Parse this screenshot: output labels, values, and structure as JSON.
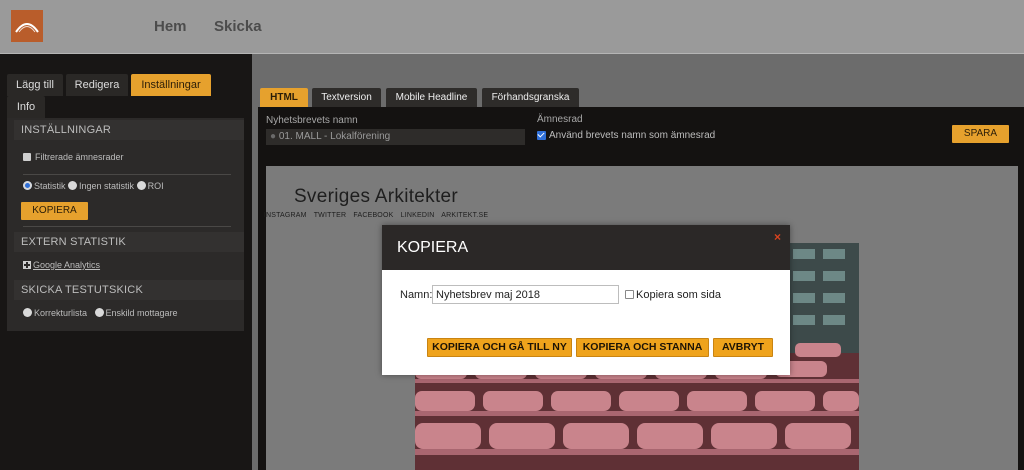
{
  "topnav": {
    "home": "Hem",
    "send": "Skicka"
  },
  "left": {
    "tabs": {
      "add": "Lägg till",
      "edit": "Redigera",
      "settings": "Inställningar",
      "info": "Info"
    },
    "settings_heading": "INSTÄLLNINGAR",
    "filtered_subjects": "Filtrerade ämnesrader",
    "stats_options": {
      "statistics": "Statistik",
      "no_statistics": "Ingen statistik",
      "roi": "ROI"
    },
    "copy_button": "KOPIERA",
    "external_heading": "EXTERN STATISTIK",
    "google_analytics": "Google Analytics",
    "test_heading": "SKICKA TESTUTSKICK",
    "test_options": {
      "proofread": "Korrekturlista",
      "single": "Enskild mottagare"
    }
  },
  "right": {
    "tabs": {
      "html": "HTML",
      "text": "Textversion",
      "mobile": "Mobile Headline",
      "preview": "Förhandsgranska"
    },
    "name_label": "Nyhetsbrevets namn",
    "name_value": "01. MALL - Lokalförening",
    "subject_label": "Ämnesrad",
    "use_name_label": "Använd brevets namn som ämnesrad",
    "save_button": "SPARA"
  },
  "preview": {
    "title": "Sveriges Arkitekter",
    "social": "INSTAGRAM TWITTER FACEBOOK LINKEDIN ARKITEKT.SE"
  },
  "modal": {
    "title": "KOPIERA",
    "close": "×",
    "name_label": "Namn:",
    "name_value": "Nyhetsbrev maj 2018",
    "copy_as_page": "Kopiera som sida",
    "btn_copy_new": "KOPIERA OCH GÅ TILL NY",
    "btn_copy_stay": "KOPIERA OCH STANNA",
    "btn_cancel": "AVBRYT"
  },
  "colors": {
    "accent": "#e6a12d",
    "logo": "#b95d2b",
    "dark": "#181615",
    "checkbox": "#2f6fd8"
  }
}
